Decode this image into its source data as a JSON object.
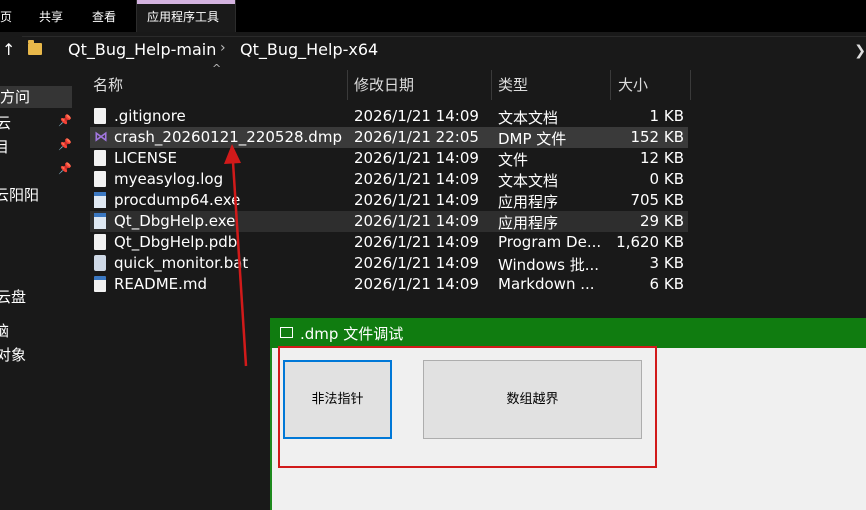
{
  "ribbon": {
    "tabs": [
      "页",
      "共享",
      "查看",
      "应用程序工具"
    ]
  },
  "address": {
    "up_glyph": "↑",
    "crumbs": [
      "Qt_Bug_Help-main",
      "Qt_Bug_Help-x64"
    ],
    "separator": "›",
    "end_glyph": "❯"
  },
  "sidebar": {
    "items": [
      "方问",
      "云",
      "目",
      "云阳阳",
      "云盘",
      "脑",
      "对象"
    ]
  },
  "columns": {
    "name": "名称",
    "date": "修改日期",
    "type": "类型",
    "size": "大小",
    "sort_glyph": "^"
  },
  "files": [
    {
      "icon": "text-file-icon",
      "name": ".gitignore",
      "date": "2026/1/21 14:09",
      "type": "文本文档",
      "size": "1 KB"
    },
    {
      "icon": "visual-studio-icon",
      "name": "crash_20260121_220528.dmp",
      "date": "2026/1/21 22:05",
      "type": "DMP 文件",
      "size": "152 KB"
    },
    {
      "icon": "file-icon",
      "name": "LICENSE",
      "date": "2026/1/21 14:09",
      "type": "文件",
      "size": "12 KB"
    },
    {
      "icon": "text-file-icon",
      "name": "myeasylog.log",
      "date": "2026/1/21 14:09",
      "type": "文本文档",
      "size": "0 KB"
    },
    {
      "icon": "application-icon",
      "name": "procdump64.exe",
      "date": "2026/1/21 14:09",
      "type": "应用程序",
      "size": "705 KB"
    },
    {
      "icon": "application-icon",
      "name": "Qt_DbgHelp.exe",
      "date": "2026/1/21 14:09",
      "type": "应用程序",
      "size": "29 KB"
    },
    {
      "icon": "pdb-file-icon",
      "name": "Qt_DbgHelp.pdb",
      "date": "2026/1/21 14:09",
      "type": "Program De...",
      "size": "1,620 KB"
    },
    {
      "icon": "batch-file-icon",
      "name": "quick_monitor.bat",
      "date": "2026/1/21 14:09",
      "type": "Windows 批...",
      "size": "3 KB"
    },
    {
      "icon": "readme-file-icon",
      "name": "README.md",
      "date": "2026/1/21 14:09",
      "type": "Markdown ...",
      "size": "6 KB"
    }
  ],
  "dialog": {
    "title": ".dmp 文件调试",
    "button_null_pointer": "非法指针",
    "button_out_of_bounds": "数组越界"
  },
  "colors": {
    "dialog_title_bar": "#107c10",
    "annotation_red": "#d11a1a",
    "focus_blue": "#0078d7"
  }
}
